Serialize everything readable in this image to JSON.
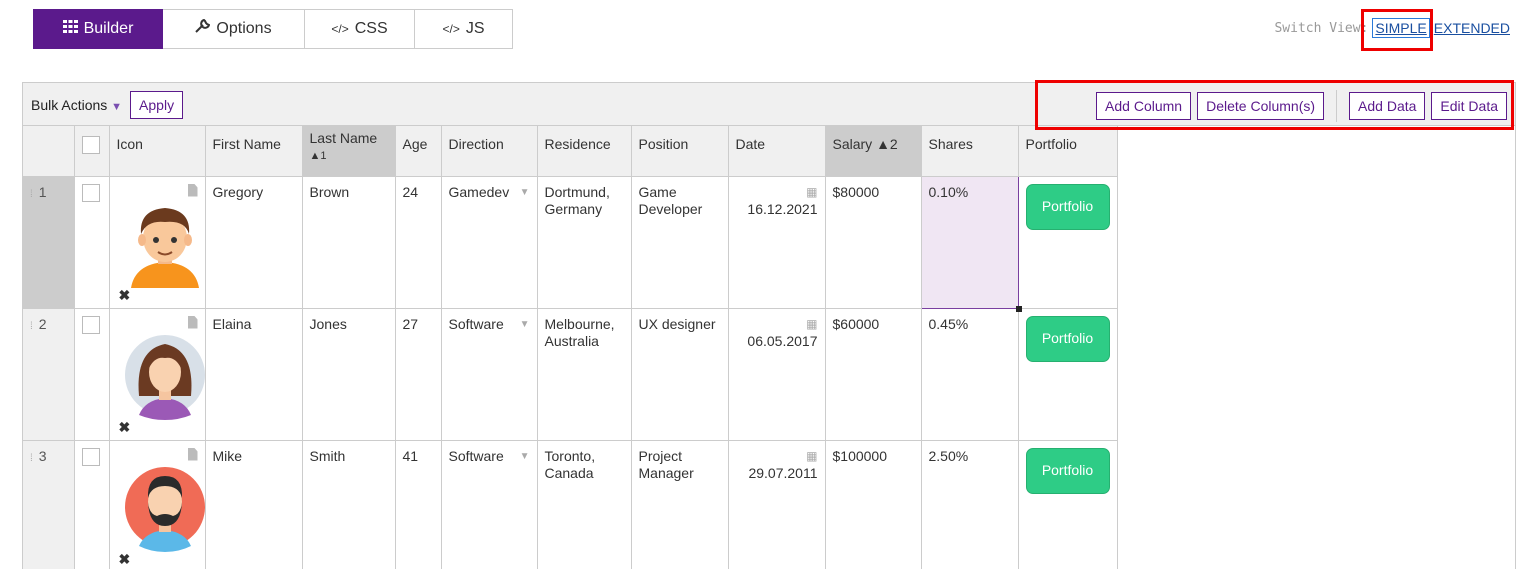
{
  "tabs": [
    {
      "label": "Builder",
      "icon": "grid-icon"
    },
    {
      "label": "Options",
      "icon": "wrench-icon"
    },
    {
      "label": "CSS",
      "icon": "code-icon"
    },
    {
      "label": "JS",
      "icon": "code-icon"
    }
  ],
  "switch_view": {
    "label": "Switch View:",
    "simple": "SIMPLE",
    "extended": "EXTENDED"
  },
  "toolbar": {
    "bulk_actions": "Bulk Actions",
    "apply": "Apply",
    "add_column": "Add Column",
    "delete_columns": "Delete Column(s)",
    "add_data": "Add Data",
    "edit_data": "Edit Data"
  },
  "columns": {
    "icon": "Icon",
    "first_name": "First Name",
    "last_name": "Last Name",
    "last_name_sort": "▲1",
    "age": "Age",
    "direction": "Direction",
    "residence": "Residence",
    "position": "Position",
    "date": "Date",
    "salary": "Salary ▲2",
    "shares": "Shares",
    "portfolio": "Portfolio"
  },
  "rows": [
    {
      "num": "1",
      "first": "Gregory",
      "last": "Brown",
      "age": "24",
      "direction": "Gamedev",
      "residence": "Dortmund, Germany",
      "position": "Game Developer",
      "date": "16.12.2021",
      "salary": "$80000",
      "shares": "0.10%",
      "portfolio": "Portfolio"
    },
    {
      "num": "2",
      "first": "Elaina",
      "last": "Jones",
      "age": "27",
      "direction": "Software",
      "residence": "Melbourne, Australia",
      "position": "UX designer",
      "date": "06.05.2017",
      "salary": "$60000",
      "shares": "0.45%",
      "portfolio": "Portfolio"
    },
    {
      "num": "3",
      "first": "Mike",
      "last": "Smith",
      "age": "41",
      "direction": "Software",
      "residence": "Toronto, Canada",
      "position": "Project Manager",
      "date": "29.07.2011",
      "salary": "$100000",
      "shares": "2.50%",
      "portfolio": "Portfolio"
    }
  ],
  "colors": {
    "accent": "#5b1a8c",
    "portfolio_button": "#2ecc86",
    "highlight_box": "#ee0000"
  }
}
